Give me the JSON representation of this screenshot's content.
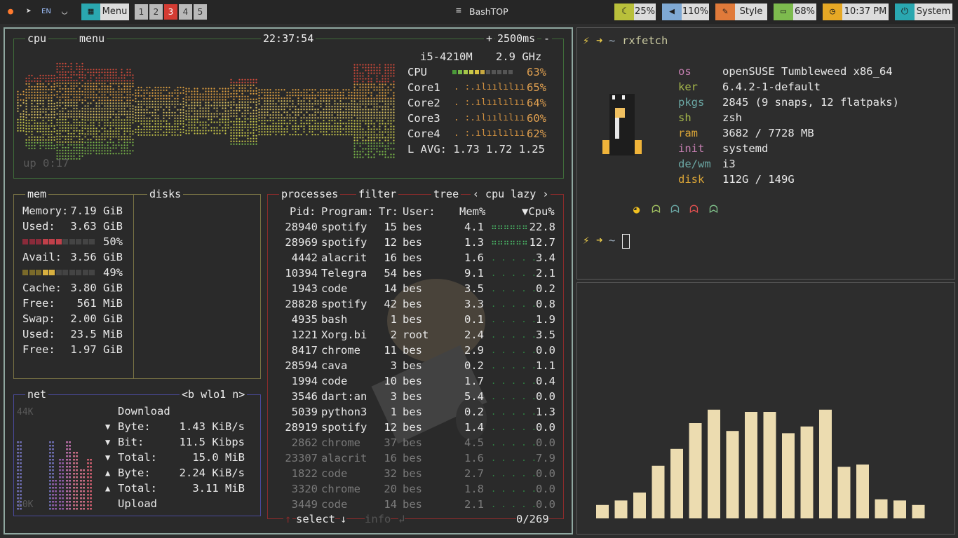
{
  "topbar": {
    "lang": "EN",
    "menu_label": "Menu",
    "workspaces": [
      "1",
      "2",
      "3",
      "4",
      "5"
    ],
    "active_workspace": "3",
    "window_title": "BashTOP",
    "brightness": "25%",
    "volume": "110%",
    "style_label": "Style",
    "battery": "68%",
    "clock": "10:37 PM",
    "system_label": "System",
    "colors": {
      "brightness": "#b9c03b",
      "volume": "#7fa9d4",
      "style": "#e07a3a",
      "battery": "#7dbb4e",
      "clock": "#e6a825",
      "system": "#2aa7b0"
    }
  },
  "cpu": {
    "title": "cpu",
    "menu_title": "menu",
    "clock": "22:37:54",
    "plus": "+",
    "interval": "2500ms",
    "minus": "-",
    "model": "i5-4210M",
    "freq": "2.9 GHz",
    "rows": [
      {
        "label": "CPU",
        "pct": "63%"
      },
      {
        "label": "Core1",
        "pct": "65%"
      },
      {
        "label": "Core2",
        "pct": "64%"
      },
      {
        "label": "Core3",
        "pct": "60%"
      },
      {
        "label": "Core4",
        "pct": "62%"
      }
    ],
    "load_avg": "L AVG: 1.73 1.72 1.25",
    "uptime": "up 0:17"
  },
  "mem": {
    "title": "mem",
    "disks_title": "disks",
    "lines": [
      {
        "label": "Memory:",
        "value": "7.19 GiB"
      },
      {
        "label": "Used:",
        "value": "3.63 GiB"
      },
      {
        "label": "",
        "value": "50%"
      },
      {
        "label": "Avail:",
        "value": "3.56 GiB"
      },
      {
        "label": "",
        "value": "49%"
      },
      {
        "label": "Cache:",
        "value": "3.80 GiB"
      },
      {
        "label": "Free:",
        "value": "561 MiB"
      },
      {
        "label": "Swap:",
        "value": "2.00 GiB"
      },
      {
        "label": "Used:",
        "value": "23.5 MiB"
      },
      {
        "label": "Free:",
        "value": "1.97 GiB"
      }
    ],
    "used_fraction": 0.5,
    "avail_fraction": 0.49
  },
  "net": {
    "title": "net",
    "iface": "<b wlo1 n>",
    "scale_top": "44K",
    "scale_bottom": "10K",
    "download": "Download",
    "upload": "Upload",
    "rows": [
      {
        "arrow": "▼",
        "label": "Byte:",
        "value": "1.43 KiB/s"
      },
      {
        "arrow": "▼",
        "label": "Bit:",
        "value": "11.5 Kibps"
      },
      {
        "arrow": "▼",
        "label": "Total:",
        "value": "15.0 MiB"
      },
      {
        "arrow": "▲",
        "label": "Byte:",
        "value": "2.24 KiB/s"
      },
      {
        "arrow": "▲",
        "label": "Total:",
        "value": "3.11 MiB"
      }
    ]
  },
  "proc": {
    "title": "processes",
    "filter": "filter",
    "tree": "tree",
    "sort": "‹ cpu lazy ›",
    "headers": {
      "pid": "Pid:",
      "program": "Program:",
      "threads": "Tr:",
      "user": "User:",
      "mem": "Mem%",
      "cpu": "▼Cpu%"
    },
    "rows": [
      {
        "pid": "28940",
        "program": "spotify",
        "threads": "15",
        "user": "bes",
        "mem": "4.1",
        "cpu": "22.8"
      },
      {
        "pid": "28969",
        "program": "spotify",
        "threads": "12",
        "user": "bes",
        "mem": "1.3",
        "cpu": "12.7"
      },
      {
        "pid": "4442",
        "program": "alacrit",
        "threads": "16",
        "user": "bes",
        "mem": "1.6",
        "cpu": "3.4"
      },
      {
        "pid": "10394",
        "program": "Telegra",
        "threads": "54",
        "user": "bes",
        "mem": "9.1",
        "cpu": "2.1"
      },
      {
        "pid": "1943",
        "program": "code",
        "threads": "14",
        "user": "bes",
        "mem": "3.5",
        "cpu": "0.2"
      },
      {
        "pid": "28828",
        "program": "spotify",
        "threads": "42",
        "user": "bes",
        "mem": "3.3",
        "cpu": "0.8"
      },
      {
        "pid": "4935",
        "program": "bash",
        "threads": "1",
        "user": "bes",
        "mem": "0.1",
        "cpu": "1.9"
      },
      {
        "pid": "1221",
        "program": "Xorg.bi",
        "threads": "2",
        "user": "root",
        "mem": "2.4",
        "cpu": "3.5"
      },
      {
        "pid": "8417",
        "program": "chrome",
        "threads": "11",
        "user": "bes",
        "mem": "2.9",
        "cpu": "0.0"
      },
      {
        "pid": "28594",
        "program": "cava",
        "threads": "3",
        "user": "bes",
        "mem": "0.2",
        "cpu": "1.1"
      },
      {
        "pid": "1994",
        "program": "code",
        "threads": "10",
        "user": "bes",
        "mem": "1.7",
        "cpu": "0.4"
      },
      {
        "pid": "3546",
        "program": "dart:an",
        "threads": "3",
        "user": "bes",
        "mem": "5.4",
        "cpu": "0.0"
      },
      {
        "pid": "5039",
        "program": "python3",
        "threads": "1",
        "user": "bes",
        "mem": "0.2",
        "cpu": "1.3"
      },
      {
        "pid": "28919",
        "program": "spotify",
        "threads": "12",
        "user": "bes",
        "mem": "1.4",
        "cpu": "0.0"
      },
      {
        "pid": "2862",
        "program": "chrome",
        "threads": "37",
        "user": "bes",
        "mem": "4.5",
        "cpu": "0.0"
      },
      {
        "pid": "23307",
        "program": "alacrit",
        "threads": "16",
        "user": "bes",
        "mem": "1.6",
        "cpu": "7.9"
      },
      {
        "pid": "1822",
        "program": "code",
        "threads": "32",
        "user": "bes",
        "mem": "2.7",
        "cpu": "0.0"
      },
      {
        "pid": "3320",
        "program": "chrome",
        "threads": "20",
        "user": "bes",
        "mem": "1.8",
        "cpu": "0.0"
      },
      {
        "pid": "3449",
        "program": "code",
        "threads": "14",
        "user": "bes",
        "mem": "2.1",
        "cpu": "0.0"
      }
    ],
    "select": "select",
    "info": "info",
    "count": "0/269"
  },
  "terminal": {
    "prompt_symbol": "⚡",
    "arrow": "➜",
    "tilde": "~",
    "command": "rxfetch",
    "info": [
      {
        "key": "os",
        "value": "openSUSE Tumbleweed x86_64"
      },
      {
        "key": "ker",
        "value": "6.4.2-1-default"
      },
      {
        "key": "pkgs",
        "value": "2845 (9 snaps, 12 flatpaks)"
      },
      {
        "key": "sh",
        "value": "zsh"
      },
      {
        "key": "ram",
        "value": "3682 / 7728 MB"
      },
      {
        "key": "init",
        "value": "systemd"
      },
      {
        "key": "de/wm",
        "value": "i3"
      },
      {
        "key": "disk",
        "value": "112G / 149G"
      }
    ]
  },
  "cava": {
    "bar_color": "#ecdcb0",
    "levels": [
      0.12,
      0.16,
      0.23,
      0.47,
      0.62,
      0.85,
      0.97,
      0.78,
      0.95,
      0.95,
      0.76,
      0.82,
      0.97,
      0.46,
      0.48,
      0.17,
      0.16,
      0.12
    ]
  }
}
